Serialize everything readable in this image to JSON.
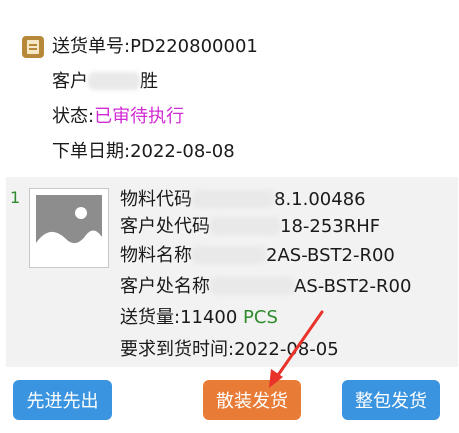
{
  "order": {
    "delivery_no": "送货单号:PD220800001",
    "customer_label": "客户",
    "customer_visible": "胜",
    "status_label": "状态:",
    "status_value": "已审待执行",
    "order_date": "下单日期:2022-08-08"
  },
  "item": {
    "index": "1",
    "material_code_label": "物料代码",
    "material_code_value": "8.1.00486",
    "customer_code_label": "客户处代码",
    "customer_code_value": "18-253RHF",
    "material_name_label": "物料名称",
    "material_name_value": "2AS-BST2-R00",
    "customer_name_label": "客户处名称",
    "customer_name_value": "AS-BST2-R00",
    "qty_label": "送货量:11400 ",
    "qty_unit": "PCS",
    "due_date": "要求到货时间:2022-08-05"
  },
  "buttons": {
    "fifo": "先进先出",
    "bulk": "散装发货",
    "whole": "整包发货"
  },
  "colors": {
    "status": "#d12bd4",
    "primary_button": "#3a94e0",
    "highlight_button": "#e87b35",
    "annotation_arrow": "#e8322a"
  },
  "icons": {
    "order": "document-icon",
    "thumbnail": "image-placeholder-icon"
  }
}
